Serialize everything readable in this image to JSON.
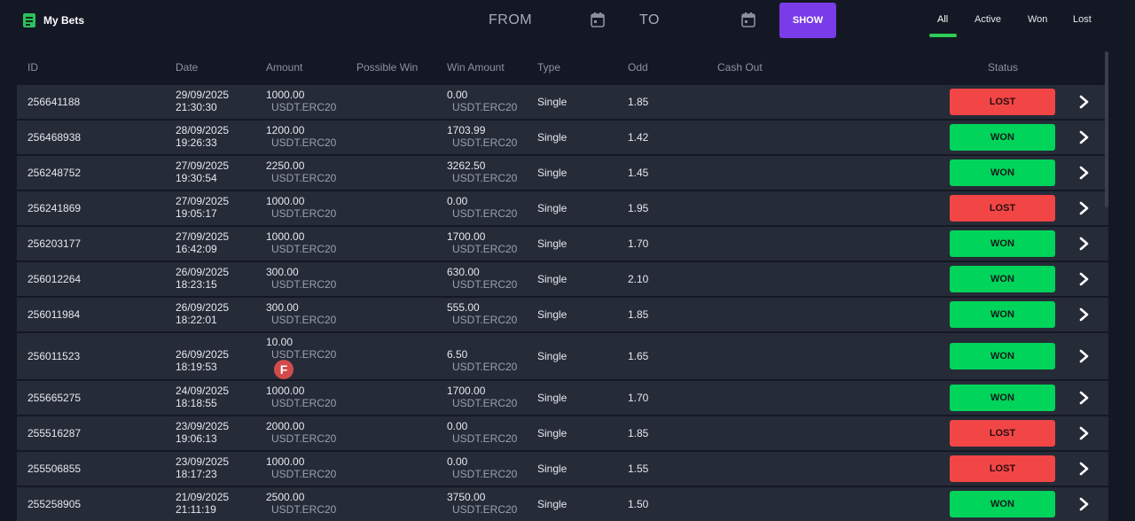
{
  "header": {
    "title": "My Bets",
    "from_label": "FROM",
    "to_label": "TO",
    "show_label": "SHOW"
  },
  "tabs": [
    {
      "label": "All",
      "selected": true
    },
    {
      "label": "Active",
      "selected": false
    },
    {
      "label": "Won",
      "selected": false
    },
    {
      "label": "Lost",
      "selected": false
    }
  ],
  "columns": [
    "ID",
    "Date",
    "Amount",
    "Possible Win",
    "Win Amount",
    "Type",
    "Odd",
    "Cash Out",
    "Status"
  ],
  "colors": {
    "won": "#00d45a",
    "lost": "#f24646",
    "accent": "#7a3ce8",
    "tab_underline": "#2ecc55"
  },
  "bets": [
    {
      "id": "256641188",
      "date": "29/09/2025",
      "time": "21:30:30",
      "amount": "1000.00",
      "currency": "USDT.ERC20",
      "win_amount": "0.00",
      "win_currency": "USDT.ERC20",
      "type": "Single",
      "odd": "1.85",
      "status": "LOST"
    },
    {
      "id": "256468938",
      "date": "28/09/2025",
      "time": "19:26:33",
      "amount": "1200.00",
      "currency": "USDT.ERC20",
      "win_amount": "1703.99",
      "win_currency": "USDT.ERC20",
      "type": "Single",
      "odd": "1.42",
      "status": "WON"
    },
    {
      "id": "256248752",
      "date": "27/09/2025",
      "time": "19:30:54",
      "amount": "2250.00",
      "currency": "USDT.ERC20",
      "win_amount": "3262.50",
      "win_currency": "USDT.ERC20",
      "type": "Single",
      "odd": "1.45",
      "status": "WON"
    },
    {
      "id": "256241869",
      "date": "27/09/2025",
      "time": "19:05:17",
      "amount": "1000.00",
      "currency": "USDT.ERC20",
      "win_amount": "0.00",
      "win_currency": "USDT.ERC20",
      "type": "Single",
      "odd": "1.95",
      "status": "LOST"
    },
    {
      "id": "256203177",
      "date": "27/09/2025",
      "time": "16:42:09",
      "amount": "1000.00",
      "currency": "USDT.ERC20",
      "win_amount": "1700.00",
      "win_currency": "USDT.ERC20",
      "type": "Single",
      "odd": "1.70",
      "status": "WON"
    },
    {
      "id": "256012264",
      "date": "26/09/2025",
      "time": "18:23:15",
      "amount": "300.00",
      "currency": "USDT.ERC20",
      "win_amount": "630.00",
      "win_currency": "USDT.ERC20",
      "type": "Single",
      "odd": "2.10",
      "status": "WON"
    },
    {
      "id": "256011984",
      "date": "26/09/2025",
      "time": "18:22:01",
      "amount": "300.00",
      "currency": "USDT.ERC20",
      "win_amount": "555.00",
      "win_currency": "USDT.ERC20",
      "type": "Single",
      "odd": "1.85",
      "status": "WON"
    },
    {
      "id": "256011523",
      "date": "26/09/2025",
      "time": "18:19:53",
      "amount": "10.00",
      "currency": "USDT.ERC20",
      "win_amount": "6.50",
      "win_currency": "USDT.ERC20",
      "type": "Single",
      "odd": "1.65",
      "status": "WON",
      "marker": "F"
    },
    {
      "id": "255665275",
      "date": "24/09/2025",
      "time": "18:18:55",
      "amount": "1000.00",
      "currency": "USDT.ERC20",
      "win_amount": "1700.00",
      "win_currency": "USDT.ERC20",
      "type": "Single",
      "odd": "1.70",
      "status": "WON"
    },
    {
      "id": "255516287",
      "date": "23/09/2025",
      "time": "19:06:13",
      "amount": "2000.00",
      "currency": "USDT.ERC20",
      "win_amount": "0.00",
      "win_currency": "USDT.ERC20",
      "type": "Single",
      "odd": "1.85",
      "status": "LOST"
    },
    {
      "id": "255506855",
      "date": "23/09/2025",
      "time": "18:17:23",
      "amount": "1000.00",
      "currency": "USDT.ERC20",
      "win_amount": "0.00",
      "win_currency": "USDT.ERC20",
      "type": "Single",
      "odd": "1.55",
      "status": "LOST"
    },
    {
      "id": "255258905",
      "date": "21/09/2025",
      "time": "21:11:19",
      "amount": "2500.00",
      "currency": "USDT.ERC20",
      "win_amount": "3750.00",
      "win_currency": "USDT.ERC20",
      "type": "Single",
      "odd": "1.50",
      "status": "WON"
    }
  ]
}
